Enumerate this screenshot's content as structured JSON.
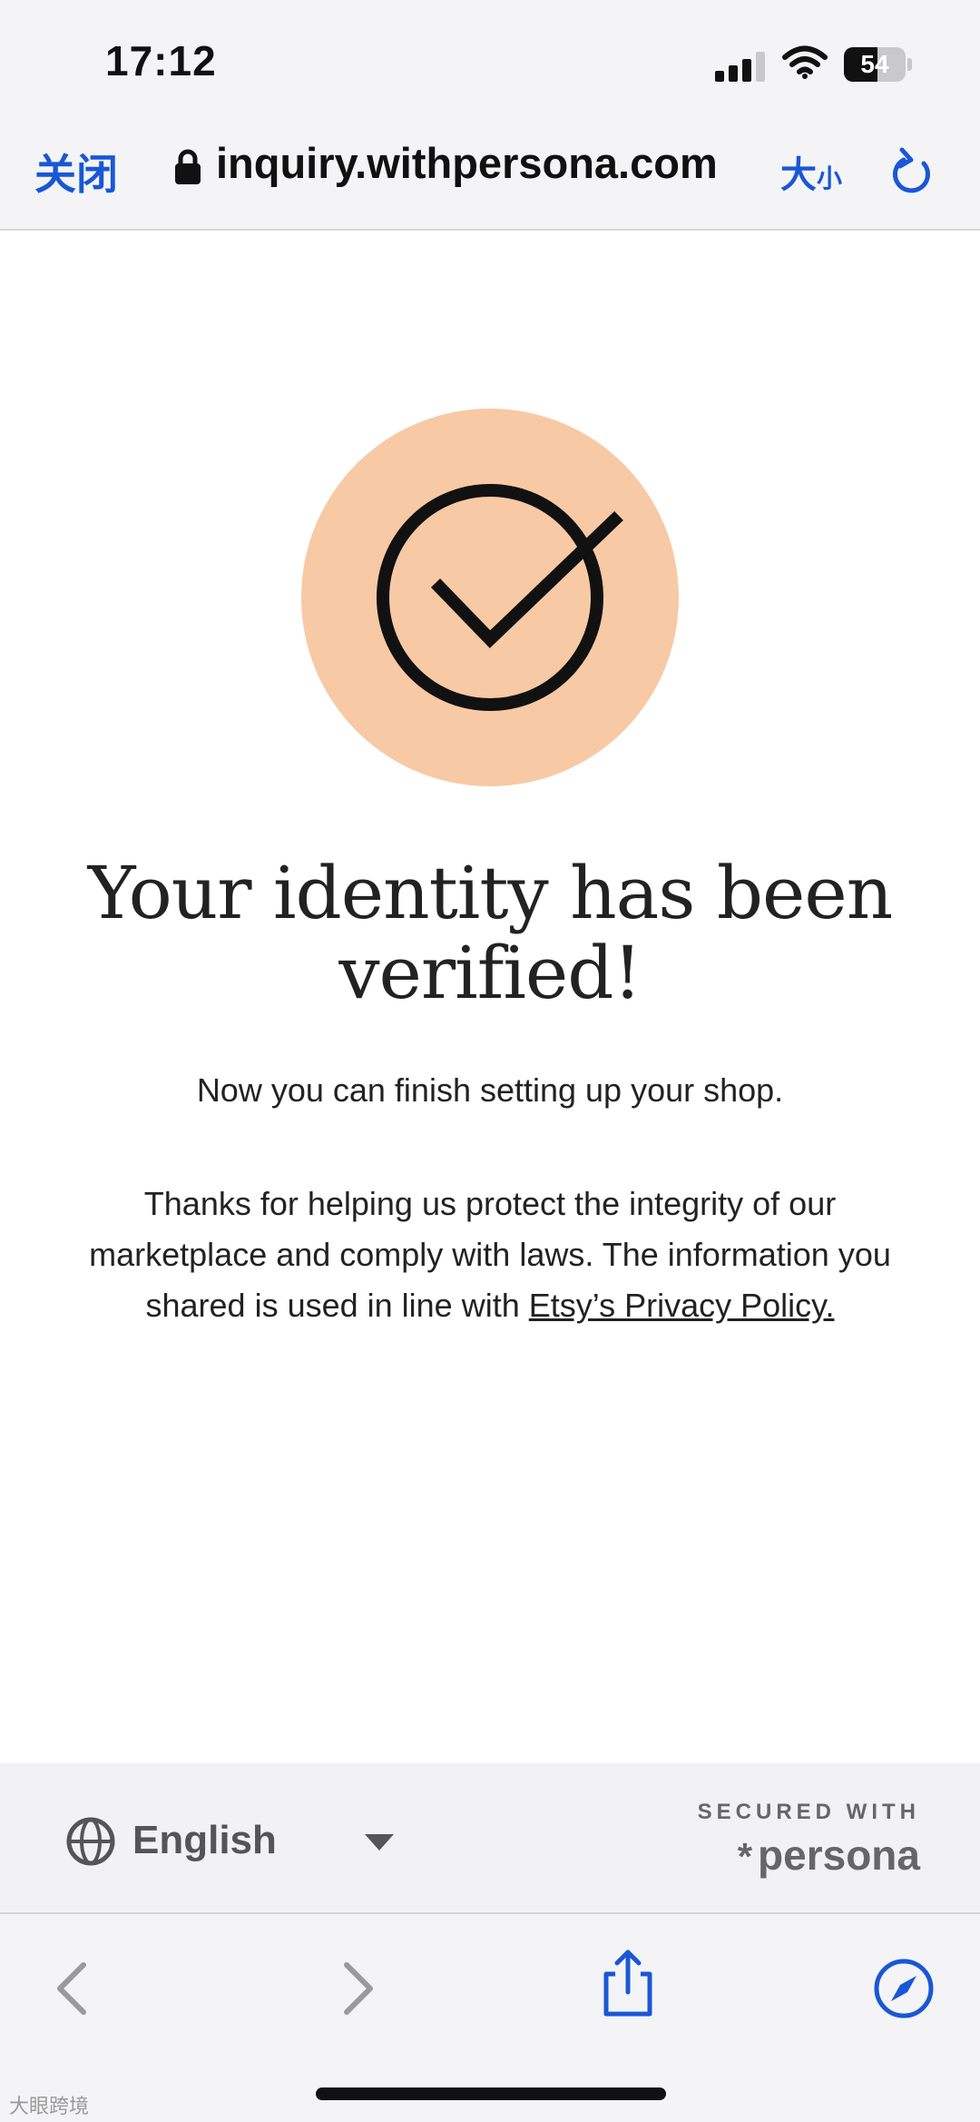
{
  "status_bar": {
    "time": "17:12",
    "battery_level": "54"
  },
  "address_bar": {
    "close_label": "关闭",
    "domain": "inquiry.withpersona.com",
    "text_size_big": "大",
    "text_size_small": "小"
  },
  "content": {
    "headline": "Your identity has been verified!",
    "subtext": "Now you can finish setting up your shop.",
    "body_text": "Thanks for helping us protect the integrity of our marketplace and comply with laws. The information you shared is used in line with ",
    "privacy_link": "Etsy’s Privacy Policy."
  },
  "footer": {
    "language": "English",
    "secured_with": "SECURED WITH",
    "brand_name": "persona",
    "brand_mark": "*"
  },
  "watermark": "大眼跨境",
  "colors": {
    "accent": "#1a57d6",
    "check_circle_bg": "#f7c9a5",
    "background": "#ffffff"
  }
}
